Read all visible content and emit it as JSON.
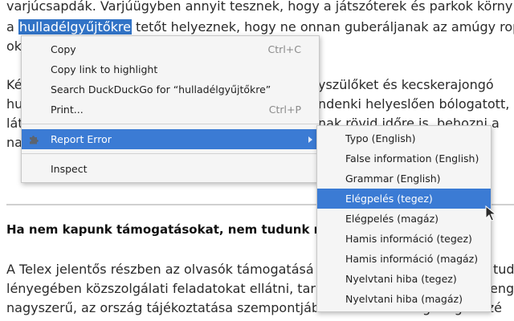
{
  "article": {
    "lines": [
      "varjúcsapdák. Varjúügyben annyit tesznek, hogy a játszóterek és parkok körny",
      "a",
      "tetőt helyeznek, hogy ne onnan guberáljanak az amúgy rop",
      "ok",
      "Ké",
      "yszülőket és kecskerajongó",
      "hu",
      "ndenki helyeslően bólogatott,",
      "lát",
      "nak rövid időre is, behozni a",
      "na"
    ],
    "selected_word": "hulladélgyűjtőkre",
    "heading": "Ha nem kapunk támogatásokat, nem tudunk m",
    "bottom_lines": [
      "A Telex jelentős részben az olvasók támogatásá",
      "tud",
      "lényegében közszolgálati feladatokat ellátni, tar",
      "eng",
      "nagyszerű, az ország tájékoztatása szempontjából kulcsfontosság dolgot azé"
    ]
  },
  "context_menu": {
    "items": [
      {
        "label": "Copy",
        "shortcut": "Ctrl+C"
      },
      {
        "label": "Copy link to highlight"
      },
      {
        "label": "Search DuckDuckGo for “hulladélgyűjtőkre”"
      },
      {
        "label": "Print...",
        "shortcut": "Ctrl+P"
      },
      {
        "label": "Report Error",
        "icon": "puzzle-piece-icon",
        "has_submenu": true
      },
      {
        "label": "Inspect"
      }
    ]
  },
  "submenu": {
    "items": [
      {
        "label": "Typo (English)"
      },
      {
        "label": "False information (English)"
      },
      {
        "label": "Grammar (English)"
      },
      {
        "label": "Elégpelés (tegez)"
      },
      {
        "label": "Elégpelés (magáz)"
      },
      {
        "label": "Hamis információ (tegez)"
      },
      {
        "label": "Hamis információ (magáz)"
      },
      {
        "label": "Nyelvtani hiba (tegez)"
      },
      {
        "label": "Nyelvtani hiba (magáz)"
      }
    ],
    "highlighted_index": 3
  },
  "colors": {
    "selection": "#3173c6",
    "menu_highlight": "#3b7bd4",
    "menu_background": "#f5f5f5"
  }
}
